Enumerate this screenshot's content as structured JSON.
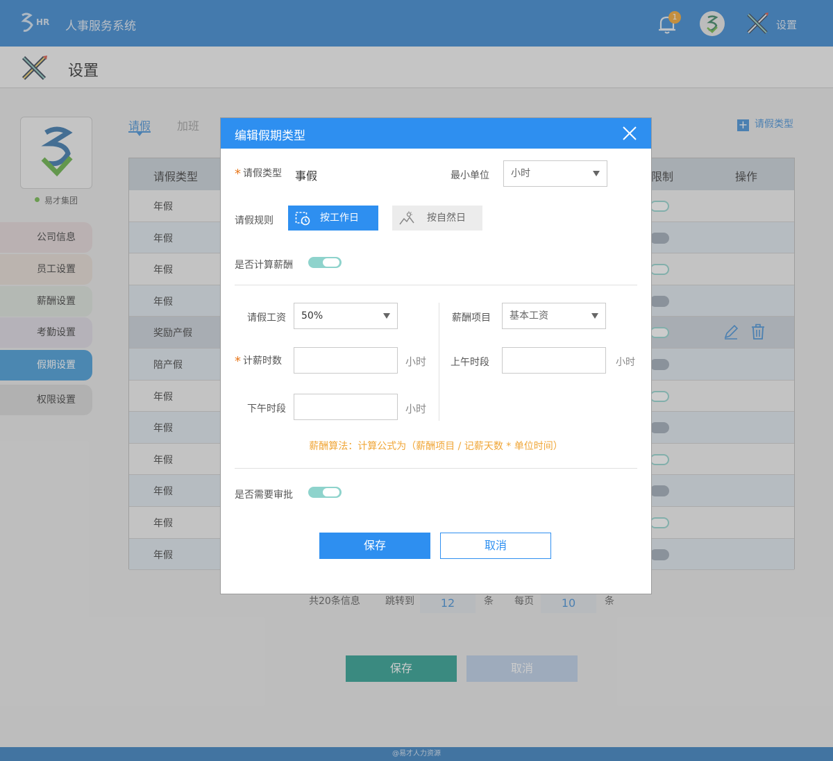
{
  "app": {
    "title": "人事服务系统",
    "badge_count": "1",
    "settings_label": "设置"
  },
  "page": {
    "title": "设置"
  },
  "company": {
    "name": "易才集团"
  },
  "sidebar": {
    "items": [
      {
        "label": "公司信息",
        "color": "#e3d6d8"
      },
      {
        "label": "员工设置",
        "color": "#e5dbd3"
      },
      {
        "label": "薪酬设置",
        "color": "#dbe2db"
      },
      {
        "label": "考勤设置",
        "color": "#dcd8e2"
      },
      {
        "label": "假期设置",
        "color": "#3a95d6"
      },
      {
        "label": "权限设置",
        "color": "#d6d6d6"
      }
    ]
  },
  "tabs": {
    "leave": "请假",
    "overtime": "加班"
  },
  "add_type_label": "请假类型",
  "table": {
    "headers": {
      "type": "请假类型",
      "limit": "限制",
      "actions": "操作"
    },
    "rows": [
      "年假",
      "年假",
      "年假",
      "年假",
      "奖励产假",
      "陪产假",
      "年假",
      "年假",
      "年假",
      "年假",
      "年假",
      "年假"
    ]
  },
  "pager": {
    "total": "共20条信息",
    "jump_label": "跳转到",
    "jump_value": "12",
    "unit1": "条",
    "per_page_label": "每页",
    "per_page_value": "10",
    "unit2": "条"
  },
  "bottom": {
    "save": "保存",
    "cancel": "取消"
  },
  "footer": "@易才人力资源",
  "modal": {
    "title": "编辑假期类型",
    "leave_type_label": "请假类型",
    "leave_type_value": "事假",
    "min_unit_label": "最小单位",
    "min_unit_value": "小时",
    "rule_label": "请假规则",
    "rule_workday": "按工作日",
    "rule_natural": "按自然日",
    "calc_salary_label": "是否计算薪酬",
    "leave_wage_label": "请假工资",
    "leave_wage_value": "50%",
    "salary_item_label": "薪酬项目",
    "salary_item_value": "基本工资",
    "pay_hours_label": "计薪时数",
    "am_period_label": "上午时段",
    "pm_period_label": "下午时段",
    "hour_unit": "小时",
    "formula": "薪酬算法：计算公式为（薪酬项目 / 记薪天数 * 单位时间）",
    "approval_label": "是否需要审批",
    "save": "保存",
    "cancel": "取消"
  }
}
